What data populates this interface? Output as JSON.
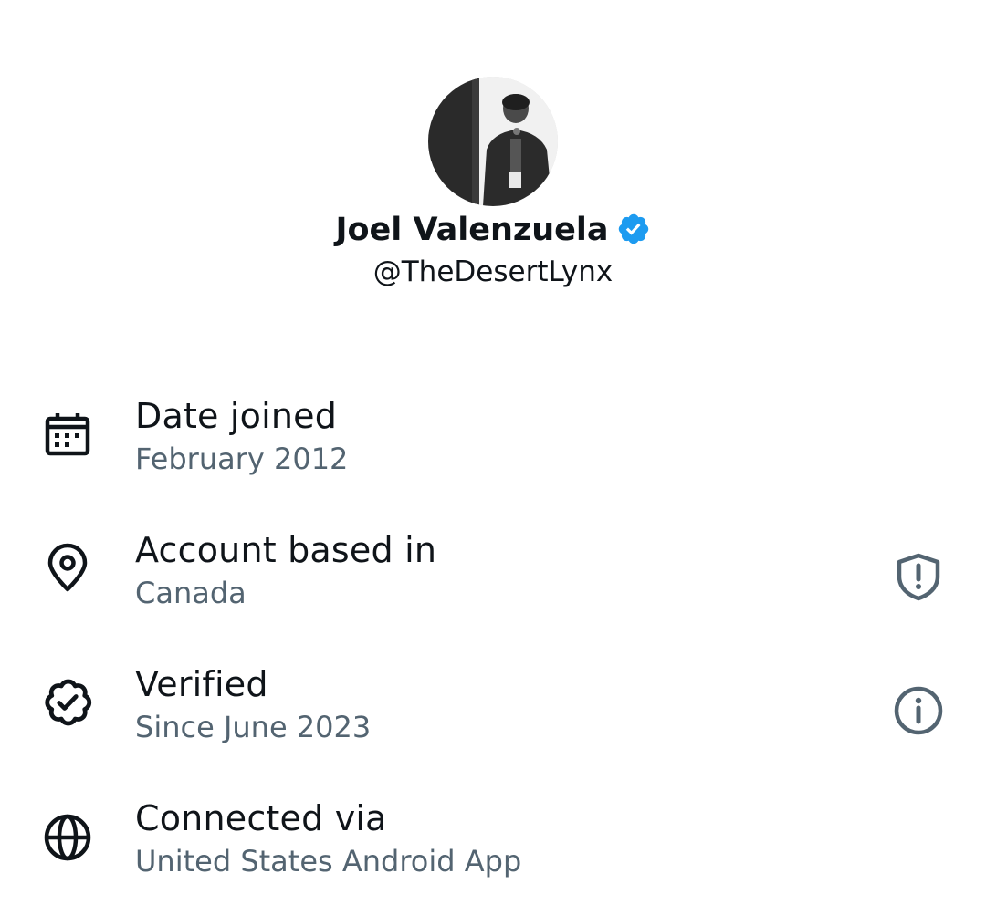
{
  "profile": {
    "display_name": "Joel Valenzuela",
    "handle": "@TheDesertLynx",
    "verified_badge_icon": "verified-badge-icon",
    "verified_badge_color": "#1d9bf0"
  },
  "about_rows": [
    {
      "icon": "calendar-icon",
      "title": "Date joined",
      "value": "February 2012"
    },
    {
      "icon": "location-pin-icon",
      "title": "Account based in",
      "value": "Canada",
      "action_icon": "shield-alert-icon"
    },
    {
      "icon": "verified-check-icon",
      "title": "Verified",
      "value": "Since June 2023",
      "action_icon": "info-icon"
    },
    {
      "icon": "globe-icon",
      "title": "Connected via",
      "value": "United States Android App"
    }
  ],
  "colors": {
    "primary_text": "#0f1419",
    "secondary_text": "#536471",
    "icon_stroke": "#0f1419",
    "action_icon_stroke": "#536471",
    "background": "#ffffff"
  }
}
